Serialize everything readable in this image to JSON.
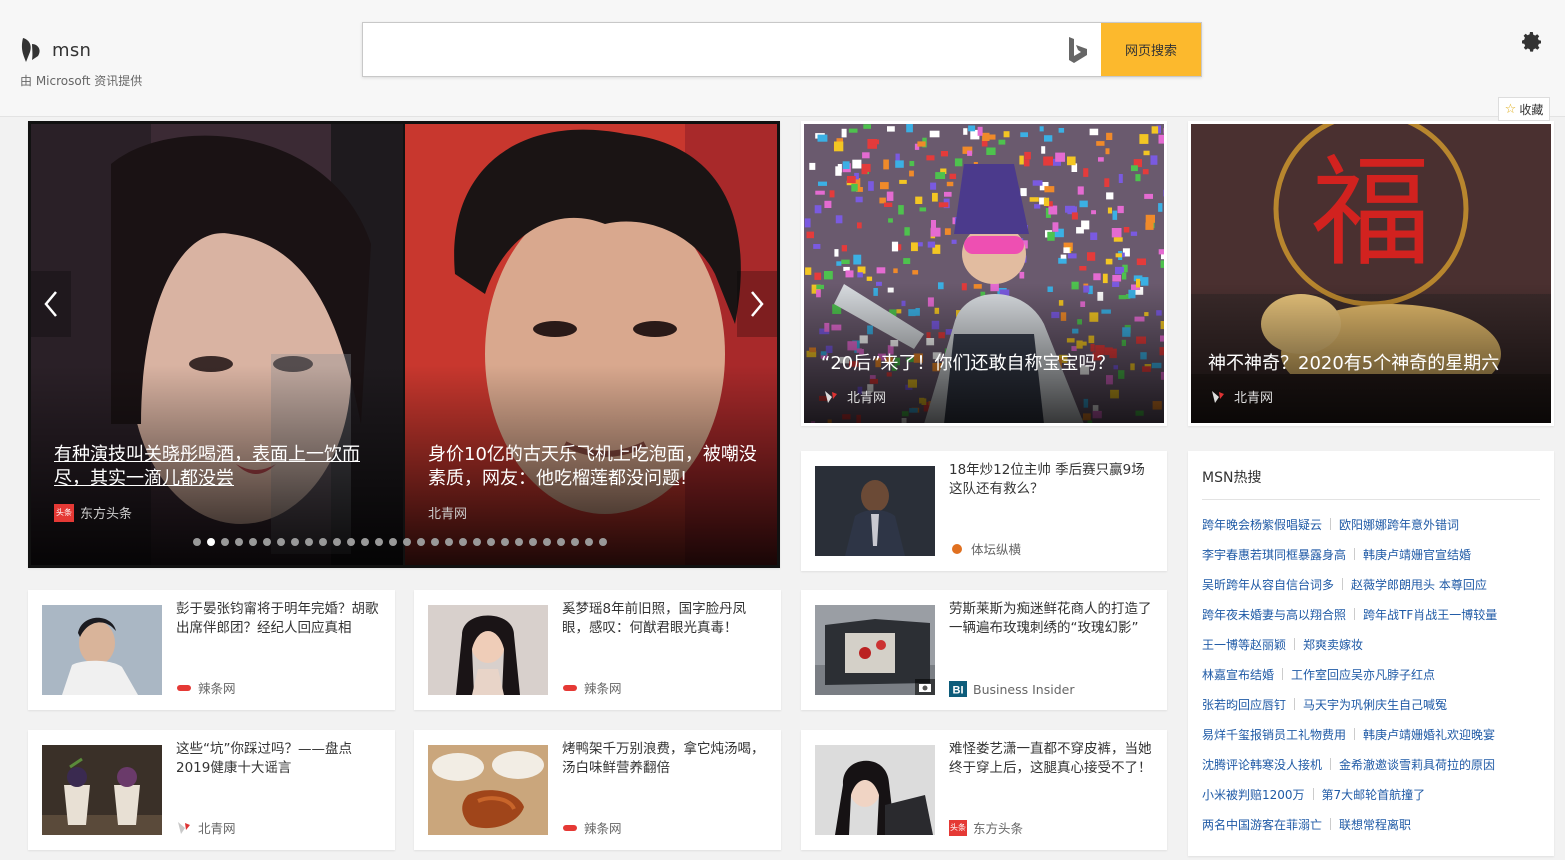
{
  "header": {
    "brand": "msn",
    "subtitle": "由 Microsoft 资讯提供",
    "search_placeholder": "",
    "search_button": "网页搜索",
    "favorite_label": "收藏"
  },
  "colors": {
    "accent": "#fcb92d",
    "link": "#1f5aa6",
    "hot_red": "#e53935"
  },
  "hero": {
    "active_dot": 1,
    "dot_count": 30,
    "slides": [
      {
        "title": "有种演技叫关晓彤喝酒，表面上一饮而尽，其实一滴儿都没尝",
        "source": "东方头条",
        "logo_text": "头条"
      },
      {
        "title": "身价10亿的古天乐飞机上吃泡面，被嘲没素质，网友：他吃榴莲都没问题!",
        "source": "北青网"
      }
    ]
  },
  "img_cards": [
    {
      "title": "“20后”来了！你们还敢自称宝宝吗？",
      "source": "北青网"
    },
    {
      "title": "神不神奇？2020有5个神奇的星期六",
      "source": "北青网"
    }
  ],
  "news": [
    {
      "title": "18年炒12位主帅 季后赛只赢9场 这队还有救么？",
      "source": "体坛纵横"
    },
    {
      "title": "彭于晏张钧甯将于明年完婚？胡歌出席伴郎团？经纪人回应真相",
      "source": "辣条网"
    },
    {
      "title": "奚梦瑶8年前旧照，国字脸丹凤眼，感叹：何猷君眼光真毒！",
      "source": "辣条网"
    },
    {
      "title": "劳斯莱斯为痴迷鲜花商人的打造了一辆遍布玫瑰刺绣的“玫瑰幻影”",
      "source": "Business Insider"
    },
    {
      "title": "这些“坑”你踩过吗？——盘点2019健康十大谣言",
      "source": "北青网"
    },
    {
      "title": "烤鸭架千万别浪费，拿它炖汤喝，汤白味鲜营养翻倍",
      "source": "辣条网"
    },
    {
      "title": "难怪娄艺潇一直都不穿皮裤，当她终于穿上后，这腿真心接受不了！",
      "source": "东方头条"
    }
  ],
  "hot": {
    "title": "MSN热搜",
    "rows": [
      [
        "跨年晚会杨紫假唱疑云",
        "欧阳娜娜跨年意外错词"
      ],
      [
        "李宇春惠若琪同框暴露身高",
        "韩庚卢靖姗官宣结婚"
      ],
      [
        "吴昕跨年从容自信台词多",
        "赵薇学郎朗甩头 本尊回应"
      ],
      [
        "跨年夜未婚妻与高以翔合照",
        "跨年战TF肖战王一博较量"
      ],
      [
        "王一博等赵丽颖",
        "郑爽卖嫁妆"
      ],
      [
        "林嘉宣布结婚",
        "工作室回应吴亦凡脖子红点"
      ],
      [
        "张若昀回应唇钉",
        "马天宇为巩俐庆生自己喊冤"
      ],
      [
        "易烊千玺报销员工礼物费用",
        "韩庚卢靖姗婚礼欢迎晚宴"
      ],
      [
        "沈腾评论韩寒没人接机",
        "金希澈邀谈雪莉具荷拉的原因"
      ],
      [
        "小米被判赔1200万",
        "第7大邮轮首航撞了"
      ],
      [
        "两名中国游客在菲溺亡",
        "联想常程离职"
      ]
    ]
  }
}
